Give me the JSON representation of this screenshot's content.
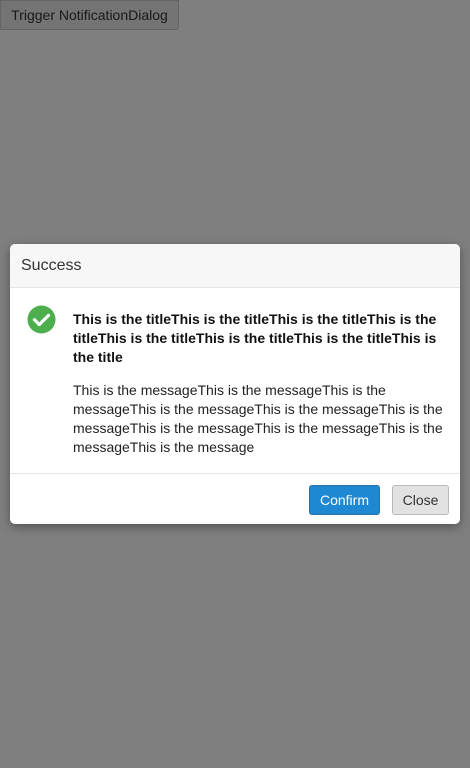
{
  "page": {
    "trigger_label": "Trigger NotificationDialog"
  },
  "dialog": {
    "header_title": "Success",
    "icon": "check-circle-icon",
    "message_title": "This is the titleThis is the titleThis is the titleThis is the titleThis is the titleThis is the titleThis is the titleThis is the title",
    "message_text": "This is the messageThis is the messageThis is the messageThis is the messageThis is the messageThis is the messageThis is the messageThis is the messageThis is the messageThis is the message",
    "confirm_label": "Confirm",
    "close_label": "Close"
  },
  "colors": {
    "success_green": "#4cae4c",
    "primary_blue": "#1e88d3",
    "overlay": "rgba(0,0,0,0.5)"
  }
}
